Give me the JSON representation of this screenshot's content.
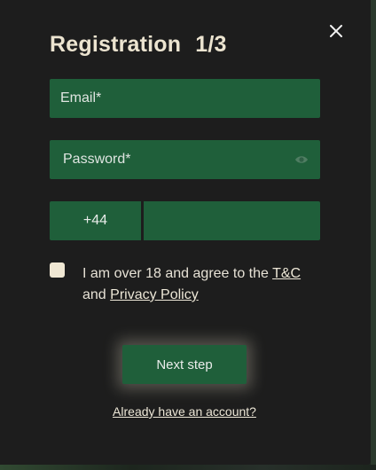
{
  "modal": {
    "title": "Registration",
    "step": "1/3",
    "close_icon": "close-icon"
  },
  "form": {
    "email_placeholder": "Email*",
    "email_value": "",
    "password_placeholder": "Password*",
    "password_value": "",
    "password_toggle_icon": "eye-icon",
    "phone_code": "+44",
    "phone_value": "",
    "agree_checked": false,
    "agree_text": "I am over 18 and agree to the",
    "tc_link": "T&C",
    "and_text": "and",
    "privacy_link": "Privacy Policy"
  },
  "actions": {
    "next_label": "Next step",
    "login_link": "Already have an account?"
  },
  "colors": {
    "modal_bg": "#1d1d1d",
    "field_bg": "#1f5f3a",
    "text_cream": "#ece4d0"
  }
}
